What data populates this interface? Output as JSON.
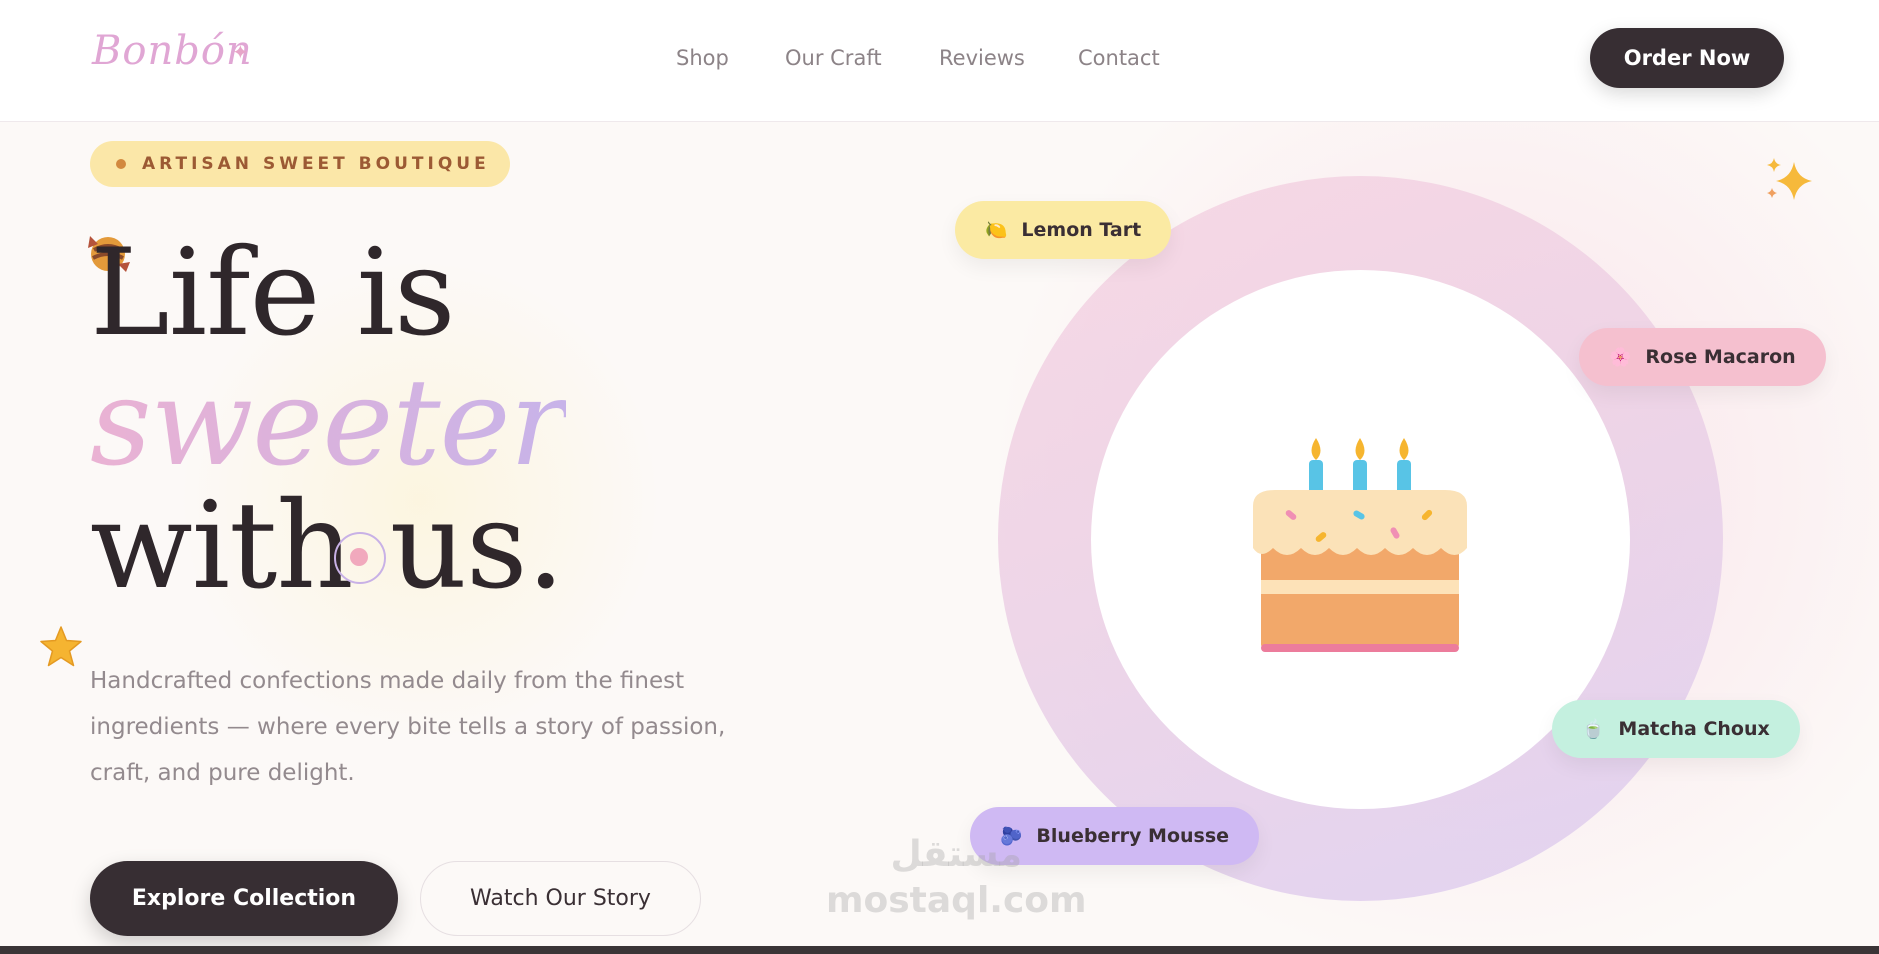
{
  "brand": {
    "logo": "Bonbón",
    "logo_spark": "✦"
  },
  "nav": {
    "links": [
      "Shop",
      "Our Craft",
      "Reviews",
      "Contact"
    ],
    "cta": "Order Now"
  },
  "hero": {
    "badge": "ARTISAN SWEET BOUTIQUE",
    "headline": [
      "Life is",
      "sweeter",
      "with us."
    ],
    "description": "Handcrafted confections made daily from the finest ingredients — where every bite tells a story of passion, craft, and pure delight.",
    "primary_button": "Explore Collection",
    "secondary_button": "Watch Our Story"
  },
  "showcase": {
    "items": [
      {
        "label": "Lemon Tart",
        "icon": "lemon-icon",
        "glyph": "🍋",
        "color": "#fbeaa3"
      },
      {
        "label": "Rose Macaron",
        "icon": "rose-icon",
        "glyph": "🌸",
        "color": "#f5c0cf"
      },
      {
        "label": "Matcha Choux",
        "icon": "matcha-icon",
        "glyph": "🍵",
        "color": "#c4f0df"
      },
      {
        "label": "Blueberry Mousse",
        "icon": "blueberry-icon",
        "glyph": "🫐",
        "color": "#cfb9f3"
      }
    ]
  },
  "watermark": {
    "arabic": "مستقل",
    "latin": "mostaql.com"
  },
  "colors": {
    "dark": "#372e33",
    "pink": "#eab2d3",
    "lavender": "#c7b3e9",
    "badge_bg": "#fbe7a8"
  }
}
